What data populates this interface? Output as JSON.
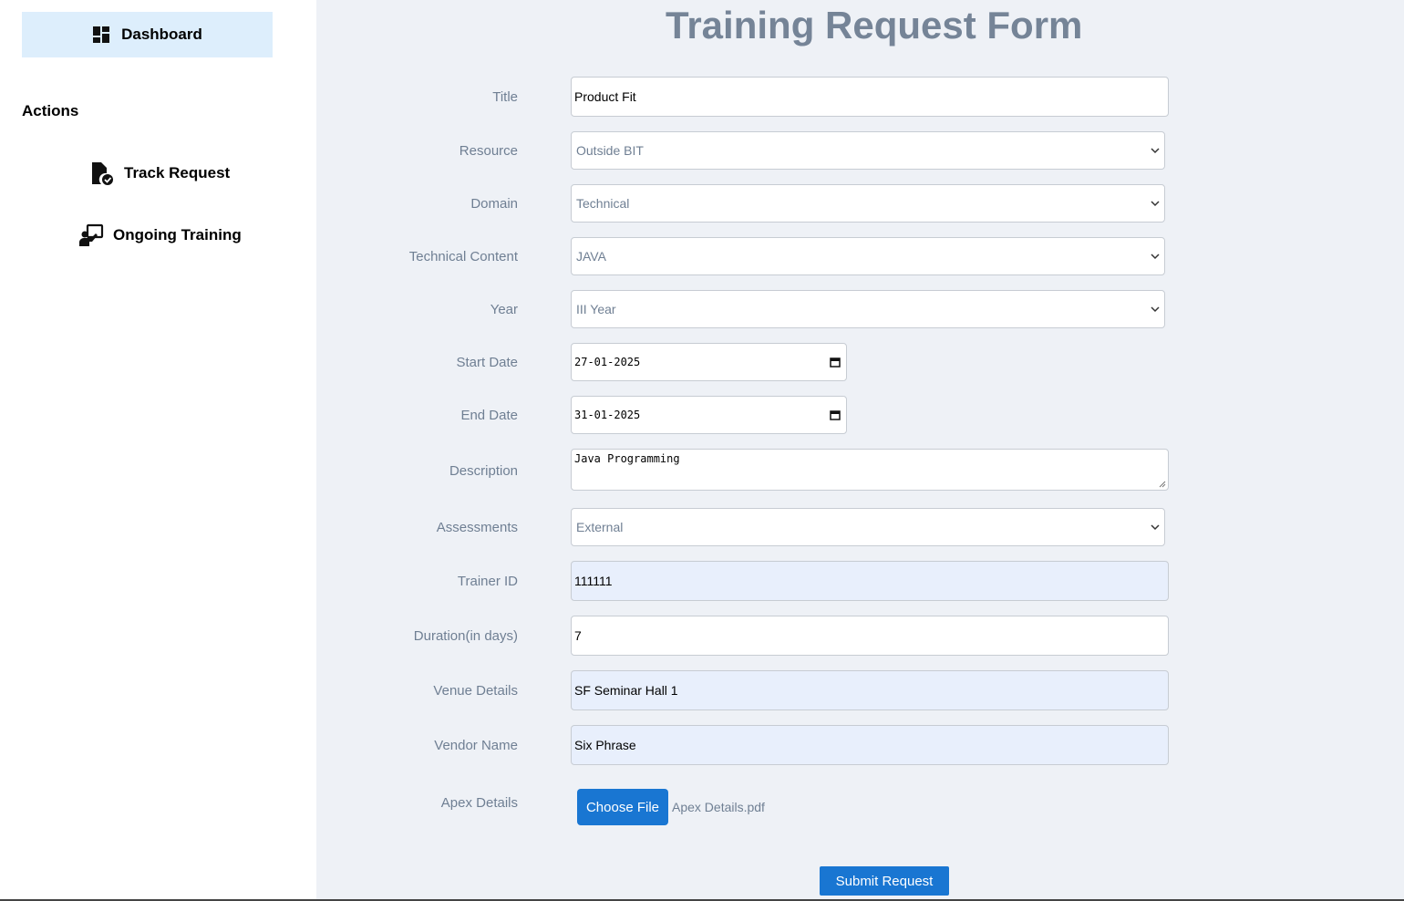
{
  "sidebar": {
    "dashboard_label": "Dashboard",
    "actions_title": "Actions",
    "items": [
      {
        "label": "Track Request",
        "icon": "file-check-icon"
      },
      {
        "label": "Ongoing Training",
        "icon": "presenter-icon"
      }
    ]
  },
  "form": {
    "title": "Training Request Form",
    "fields": {
      "title": {
        "label": "Title",
        "value": "Product Fit"
      },
      "resource": {
        "label": "Resource",
        "value": "Outside BIT"
      },
      "domain": {
        "label": "Domain",
        "value": "Technical"
      },
      "technical_content": {
        "label": "Technical Content",
        "value": "JAVA"
      },
      "year": {
        "label": "Year",
        "value": "III Year"
      },
      "start_date": {
        "label": "Start Date",
        "value": "27-01-2025"
      },
      "end_date": {
        "label": "End Date",
        "value": "31-01-2025"
      },
      "description": {
        "label": "Description",
        "value": "Java Programming"
      },
      "assessments": {
        "label": "Assessments",
        "value": "External"
      },
      "trainer_id": {
        "label": "Trainer ID",
        "value": "111111"
      },
      "duration": {
        "label": "Duration(in days)",
        "value": "7"
      },
      "venue": {
        "label": "Venue Details",
        "value": "SF Seminar Hall 1"
      },
      "vendor": {
        "label": "Vendor Name",
        "value": "Six Phrase"
      },
      "apex": {
        "label": "Apex Details",
        "button_label": "Choose File",
        "file_name": "Apex Details.pdf"
      }
    },
    "submit_label": "Submit Request"
  },
  "colors": {
    "accent": "#1976d2",
    "main_bg": "#eef1f6",
    "sidebar_active": "#ddeefc",
    "title": "#758497",
    "label": "#6f7f93",
    "autofill_bg": "#e8effc"
  }
}
